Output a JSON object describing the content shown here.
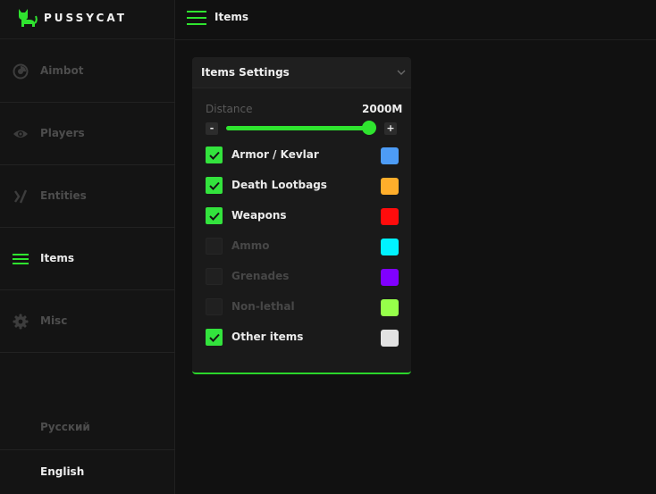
{
  "app": {
    "brand": "PUSSYCAT",
    "accent": "#2fe42f"
  },
  "sidebar": {
    "items": [
      {
        "label": "Aimbot",
        "icon": "crosshair-pie-icon",
        "active": false
      },
      {
        "label": "Players",
        "icon": "eye-icon",
        "active": false
      },
      {
        "label": "Entities",
        "icon": "entities-icon",
        "active": false
      },
      {
        "label": "Items",
        "icon": "hamburger-icon",
        "active": true
      },
      {
        "label": "Misc",
        "icon": "gear-icon",
        "active": false
      }
    ],
    "languages": [
      {
        "label": "Русский",
        "active": false
      },
      {
        "label": "English",
        "active": true
      }
    ]
  },
  "header": {
    "title": "Items"
  },
  "panel": {
    "title": "Items Settings",
    "distance": {
      "label": "Distance",
      "value": "2000M",
      "minus": "-",
      "plus": "+",
      "level": 1.0
    },
    "items": [
      {
        "label": "Armor / Kevlar",
        "checked": true,
        "color": "#4d9cf6"
      },
      {
        "label": "Death Lootbags",
        "checked": true,
        "color": "#ffae2b"
      },
      {
        "label": "Weapons",
        "checked": true,
        "color": "#ff0c0c"
      },
      {
        "label": "Ammo",
        "checked": false,
        "color": "#00f2ff"
      },
      {
        "label": "Grenades",
        "checked": false,
        "color": "#8000ff"
      },
      {
        "label": "Non-lethal",
        "checked": false,
        "color": "#96ff4a"
      },
      {
        "label": "Other items",
        "checked": true,
        "color": "#e2e2e2"
      }
    ]
  }
}
